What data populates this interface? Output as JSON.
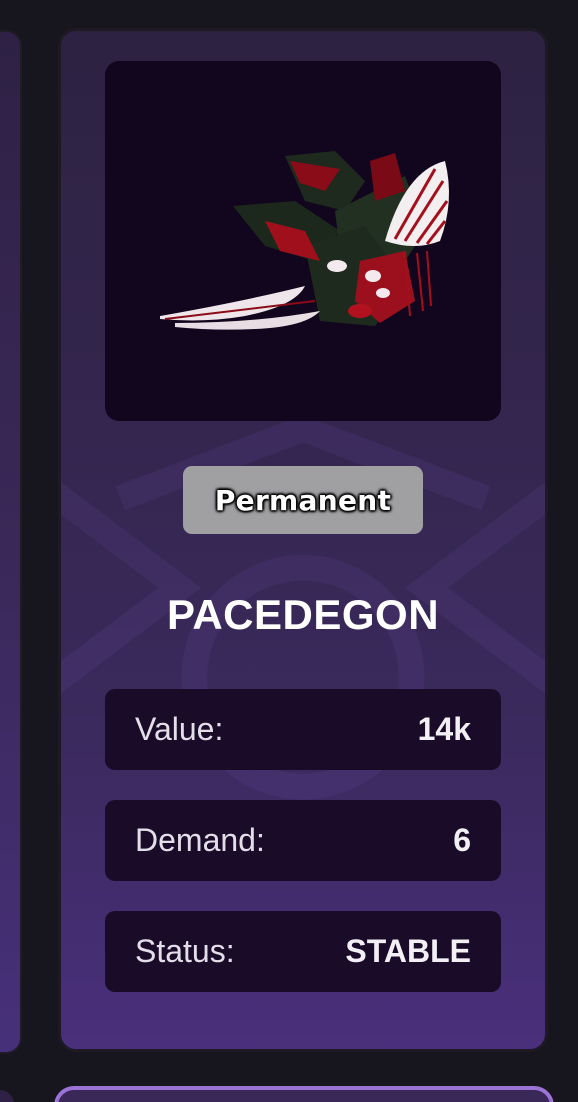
{
  "item": {
    "badge": "Permanent",
    "name": "PACEDEGON",
    "image_icon": "dragon-creature-image"
  },
  "stats": [
    {
      "label": "Value:",
      "value": "14k"
    },
    {
      "label": "Demand:",
      "value": "6"
    },
    {
      "label": "Status:",
      "value": "STABLE"
    }
  ],
  "colors": {
    "card_bg_top": "#2d2242",
    "card_bg_bottom": "#4a2f7c",
    "stat_bg": "#1a0b29",
    "badge_bg": "#a09fa2",
    "accent_border": "#9b72d6"
  }
}
